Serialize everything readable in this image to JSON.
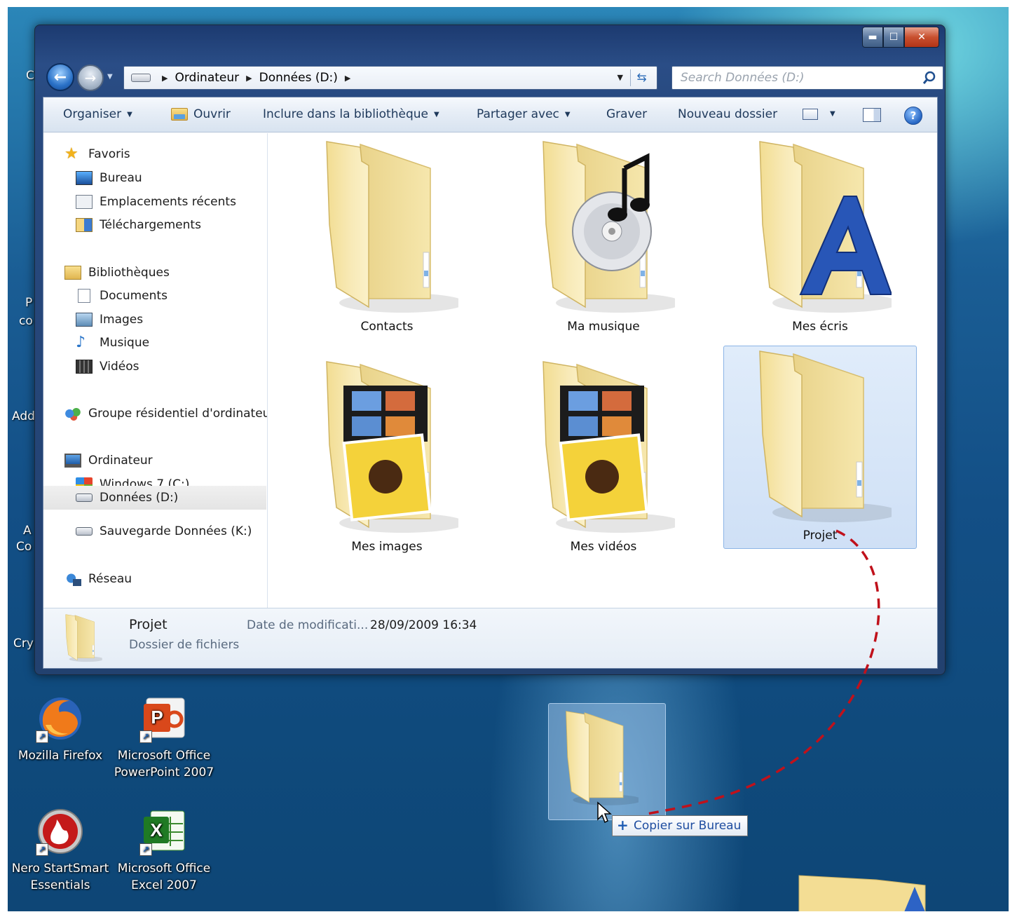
{
  "colors": {
    "desktop_top": "#2b86b8",
    "desktop_bottom": "#0e4676",
    "window_frame": "#22416f",
    "selection_bg": "#cfe0f6",
    "selection_border": "#8bb4e6",
    "toolbar_text": "#1e395b",
    "drag_arrow": "#c0111b",
    "tooltip_text": "#1f4da0"
  },
  "desktop_edge_labels": [
    "C",
    "P",
    "co",
    "Add",
    "A",
    "Co",
    "Cry"
  ],
  "window": {
    "controls": {
      "minimize": "▬",
      "maximize": "☐",
      "close": "✕"
    }
  },
  "nav": {
    "breadcrumbs": [
      "Ordinateur",
      "Données (D:)"
    ],
    "search_placeholder": "Search Données (D:)"
  },
  "toolbar": {
    "organize": "Organiser",
    "open": "Ouvrir",
    "include_library": "Inclure dans la bibliothèque",
    "share_with": "Partager avec",
    "burn": "Graver",
    "new_folder": "Nouveau dossier",
    "help": "?"
  },
  "nav_pane": {
    "favorites": {
      "label": "Favoris",
      "items": [
        "Bureau",
        "Emplacements récents",
        "Téléchargements"
      ]
    },
    "libraries": {
      "label": "Bibliothèques",
      "items": [
        "Documents",
        "Images",
        "Musique",
        "Vidéos"
      ]
    },
    "homegroup": "Groupe résidentiel d'ordinateu",
    "computer": {
      "label": "Ordinateur",
      "items": [
        "Windows 7 (C:)",
        "Données (D:)",
        "Sauvegarde Données (K:)"
      ]
    },
    "network": "Réseau",
    "selected": "Données (D:)"
  },
  "folders": [
    {
      "name": "Contacts",
      "overlay": "none"
    },
    {
      "name": "Ma musique",
      "overlay": "cd-music"
    },
    {
      "name": "Mes écris",
      "overlay": "letter-a"
    },
    {
      "name": "Mes images",
      "overlay": "photos"
    },
    {
      "name": "Mes vidéos",
      "overlay": "photos"
    },
    {
      "name": "Projet",
      "overlay": "none",
      "selected": true
    }
  ],
  "details": {
    "name": "Projet",
    "type": "Dossier de fichiers",
    "date_label": "Date de modificati...",
    "date_value": "28/09/2009 16:34"
  },
  "desktop_icons": [
    {
      "line1": "Mozilla Firefox",
      "line2": "",
      "icon": "firefox-icon"
    },
    {
      "line1": "Microsoft Office",
      "line2": "PowerPoint 2007",
      "icon": "powerpoint-icon"
    },
    {
      "line1": "Nero StartSmart",
      "line2": "Essentials",
      "icon": "nero-icon"
    },
    {
      "line1": "Microsoft Office",
      "line2": "Excel 2007",
      "icon": "excel-icon"
    }
  ],
  "drag": {
    "tooltip_plus": "+",
    "tooltip": "Copier sur Bureau"
  }
}
